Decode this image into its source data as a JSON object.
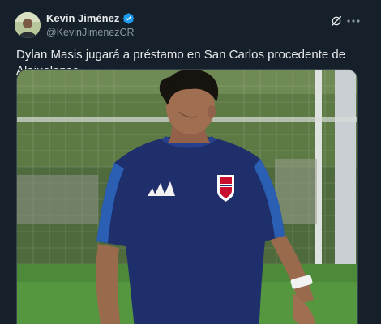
{
  "tweet": {
    "author": {
      "name": "Kevin Jiménez",
      "handle": "@KevinJimenezCR",
      "verified": true
    },
    "icons": {
      "avatar": "avatar-photo",
      "verified": "verified-badge-icon",
      "grok": "grok-icon",
      "more": "more-options-icon"
    },
    "text": "Dylan Masis jugará a préstamo en San Carlos procedente de Alajuelense",
    "media": {
      "type": "photo"
    }
  },
  "colors": {
    "background": "#15202b",
    "text_primary": "#e7e9ea",
    "text_secondary": "#8b98a5",
    "verified_blue": "#1d9bf0",
    "jersey_navy": "#1f2f6b"
  }
}
